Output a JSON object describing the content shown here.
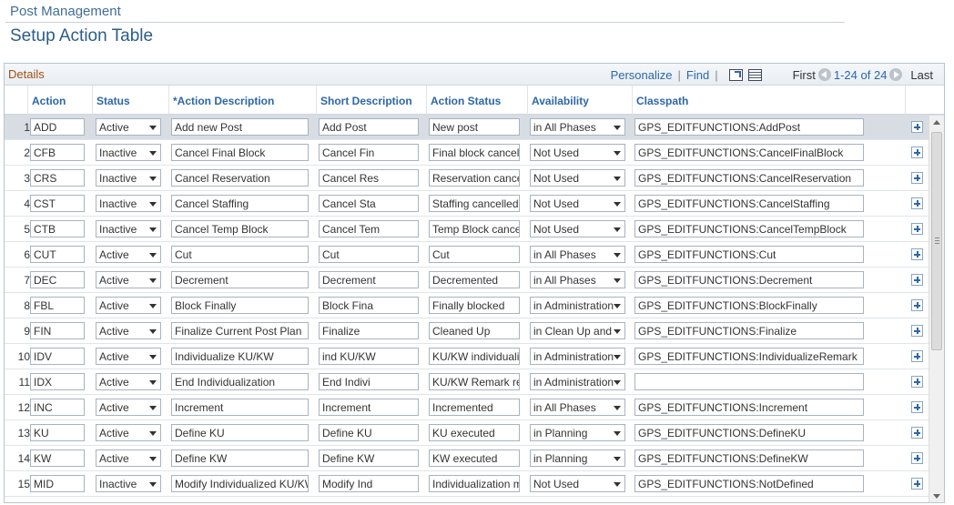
{
  "breadcrumb": "Post Management",
  "page_title": "Setup Action Table",
  "grid": {
    "title": "Details",
    "personalize": "Personalize",
    "separator": "|",
    "find": "Find",
    "first": "First",
    "range": "1-24 of 24",
    "last": "Last"
  },
  "columns": [
    "Action",
    "Status",
    "*Action Description",
    "Short Description",
    "Action Status",
    "Availability",
    "Classpath"
  ],
  "rows": [
    {
      "n": "1",
      "action": "ADD",
      "status": "Active",
      "desc": "Add new Post",
      "short": "Add Post",
      "astatus": "New post",
      "avail": "in All Phases",
      "classpath": "GPS_EDITFUNCTIONS:AddPost"
    },
    {
      "n": "2",
      "action": "CFB",
      "status": "Inactive",
      "desc": "Cancel Final Block",
      "short": "Cancel Fin",
      "astatus": "Final block cancelled",
      "avail": "Not Used",
      "classpath": "GPS_EDITFUNCTIONS:CancelFinalBlock"
    },
    {
      "n": "3",
      "action": "CRS",
      "status": "Inactive",
      "desc": "Cancel Reservation",
      "short": "Cancel Res",
      "astatus": "Reservation cancelled",
      "avail": "Not Used",
      "classpath": "GPS_EDITFUNCTIONS:CancelReservation"
    },
    {
      "n": "4",
      "action": "CST",
      "status": "Inactive",
      "desc": "Cancel Staffing",
      "short": "Cancel Sta",
      "astatus": "Staffing cancelled",
      "avail": "Not Used",
      "classpath": "GPS_EDITFUNCTIONS:CancelStaffing"
    },
    {
      "n": "5",
      "action": "CTB",
      "status": "Inactive",
      "desc": "Cancel Temp Block",
      "short": "Cancel Tem",
      "astatus": "Temp Block cancelled",
      "avail": "Not Used",
      "classpath": "GPS_EDITFUNCTIONS:CancelTempBlock"
    },
    {
      "n": "6",
      "action": "CUT",
      "status": "Active",
      "desc": "Cut",
      "short": "Cut",
      "astatus": "Cut",
      "avail": "in All Phases",
      "classpath": "GPS_EDITFUNCTIONS:Cut"
    },
    {
      "n": "7",
      "action": "DEC",
      "status": "Active",
      "desc": "Decrement",
      "short": "Decrement",
      "astatus": "Decremented",
      "avail": "in All Phases",
      "classpath": "GPS_EDITFUNCTIONS:Decrement"
    },
    {
      "n": "8",
      "action": "FBL",
      "status": "Active",
      "desc": "Block Finally",
      "short": "Block Fina",
      "astatus": "Finally blocked",
      "avail": "in Administration",
      "classpath": "GPS_EDITFUNCTIONS:BlockFinally"
    },
    {
      "n": "9",
      "action": "FIN",
      "status": "Active",
      "desc": "Finalize Current Post Plan",
      "short": "Finalize",
      "astatus": "Cleaned Up",
      "avail": "in Clean Up and",
      "classpath": "GPS_EDITFUNCTIONS:Finalize"
    },
    {
      "n": "10",
      "action": "IDV",
      "status": "Active",
      "desc": "Individualize KU/KW",
      "short": "ind KU/KW",
      "astatus": "KU/KW individualized",
      "avail": "in Administration",
      "classpath": "GPS_EDITFUNCTIONS:IndividualizeRemark"
    },
    {
      "n": "11",
      "action": "IDX",
      "status": "Active",
      "desc": "End Individualization",
      "short": "End Indivi",
      "astatus": "KU/KW Remark removed",
      "avail": "in Administration",
      "classpath": ""
    },
    {
      "n": "12",
      "action": "INC",
      "status": "Active",
      "desc": "Increment",
      "short": "Increment",
      "astatus": "Incremented",
      "avail": "in All Phases",
      "classpath": "GPS_EDITFUNCTIONS:Increment"
    },
    {
      "n": "13",
      "action": "KU",
      "status": "Active",
      "desc": "Define KU",
      "short": "Define KU",
      "astatus": "KU executed",
      "avail": "in Planning",
      "classpath": "GPS_EDITFUNCTIONS:DefineKU"
    },
    {
      "n": "14",
      "action": "KW",
      "status": "Active",
      "desc": "Define KW",
      "short": "Define KW",
      "astatus": "KW executed",
      "avail": "in Planning",
      "classpath": "GPS_EDITFUNCTIONS:DefineKW"
    },
    {
      "n": "15",
      "action": "MID",
      "status": "Inactive",
      "desc": "Modify Individualized KU/KW",
      "short": "Modify Ind",
      "astatus": "Individualization modified",
      "avail": "Not Used",
      "classpath": "GPS_EDITFUNCTIONS:NotDefined"
    }
  ]
}
